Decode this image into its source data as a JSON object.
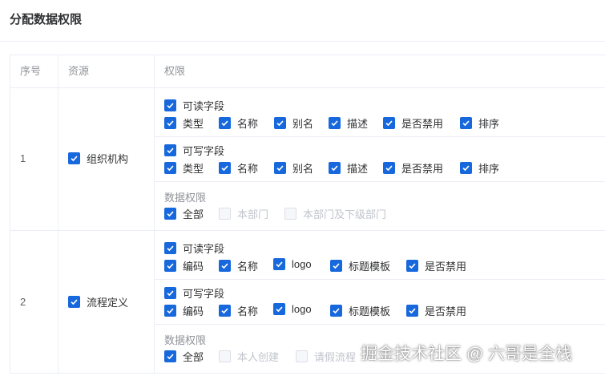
{
  "header": {
    "title": "分配数据权限"
  },
  "table": {
    "columns": [
      "序号",
      "资源",
      "权限"
    ],
    "rows": [
      {
        "index": "1",
        "resource": "组织机构",
        "readable": {
          "label": "可读字段",
          "fields": [
            "类型",
            "名称",
            "别名",
            "描述",
            "是否禁用",
            "排序"
          ]
        },
        "writable": {
          "label": "可写字段",
          "fields": [
            "类型",
            "名称",
            "别名",
            "描述",
            "是否禁用",
            "排序"
          ]
        },
        "scope": {
          "label": "数据权限",
          "options": [
            "全部",
            "本部门",
            "本部门及下级部门"
          ]
        }
      },
      {
        "index": "2",
        "resource": "流程定义",
        "readable": {
          "label": "可读字段",
          "fields": [
            "编码",
            "名称",
            "logo",
            "标题模板",
            "是否禁用"
          ]
        },
        "writable": {
          "label": "可写字段",
          "fields": [
            "编码",
            "名称",
            "logo",
            "标题模板",
            "是否禁用"
          ]
        },
        "scope": {
          "label": "数据权限",
          "options": [
            "全部",
            "本人创建",
            "请假流程"
          ]
        }
      }
    ]
  },
  "watermark": "掘金技术社区 @ 六哥是全栈",
  "colors": {
    "accent": "#1668dc",
    "border": "#ebeef5",
    "muted": "#909399",
    "disabled": "#c0c4cc"
  },
  "icons": {
    "checkbox": "check-icon"
  }
}
